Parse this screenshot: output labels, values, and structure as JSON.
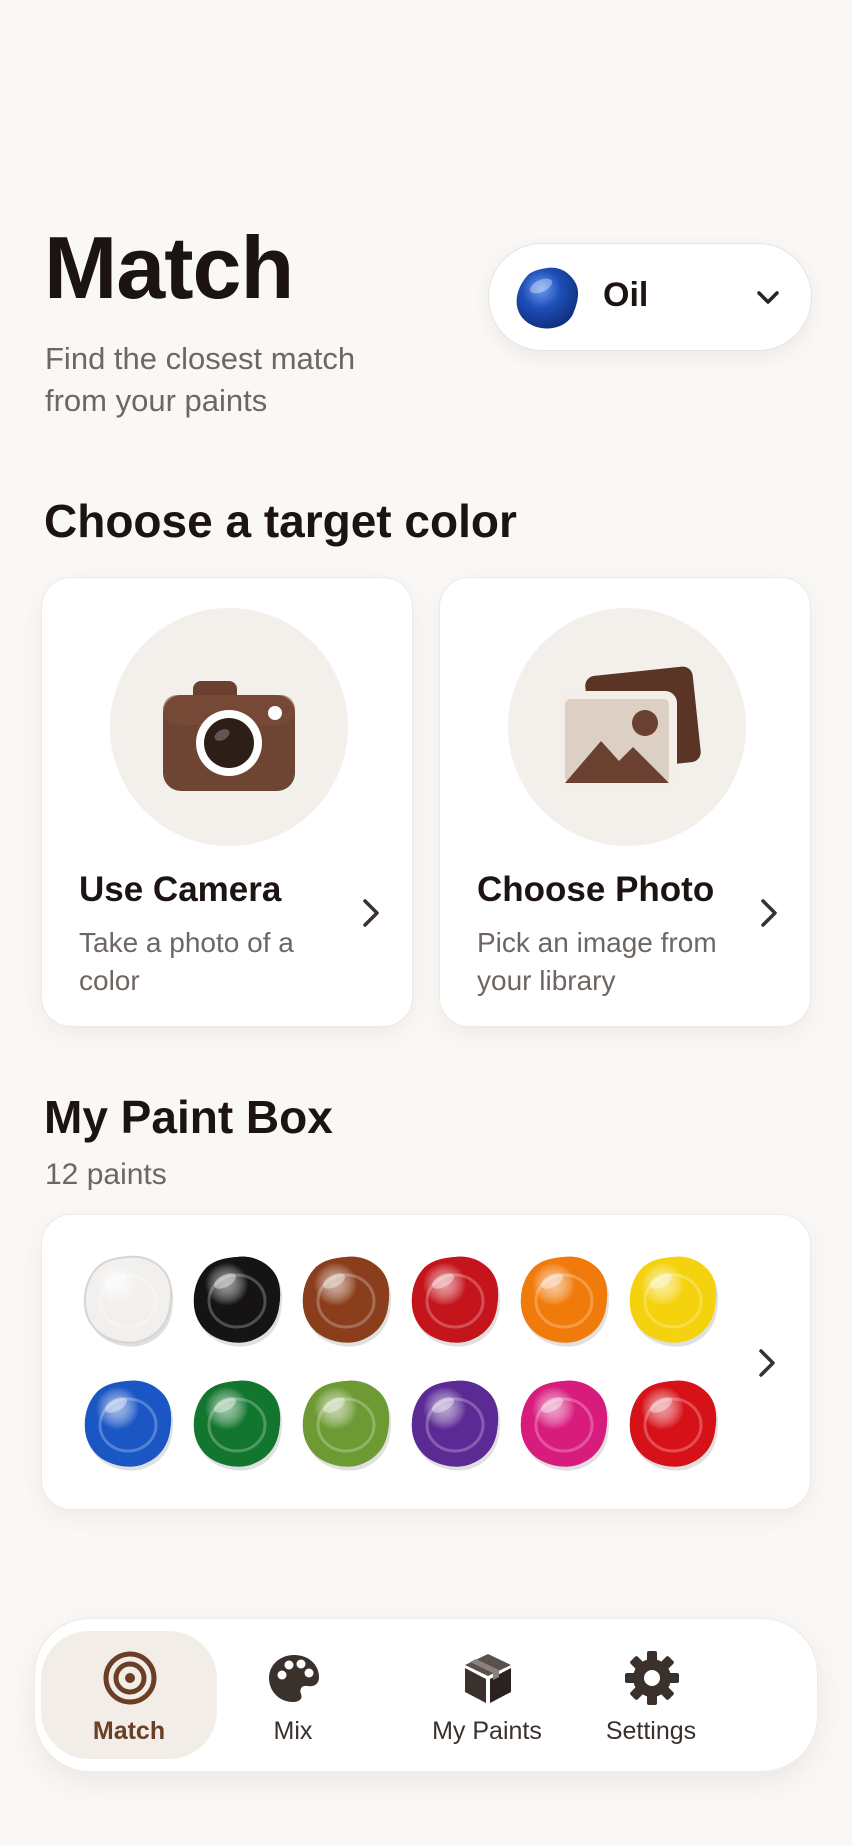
{
  "header": {
    "title": "Match",
    "subtitle": "Find the closest match from your paints"
  },
  "medium_selector": {
    "label": "Oil",
    "swatch_color": "#1E4FB8",
    "icon": "chevron-down-icon"
  },
  "target_section": {
    "title": "Choose a target color",
    "options": [
      {
        "title": "Use Camera",
        "description": "Take a photo of a color",
        "icon": "camera-icon"
      },
      {
        "title": "Choose Photo",
        "description": "Pick an image from your library",
        "icon": "photo-library-icon"
      }
    ]
  },
  "paint_box": {
    "title": "My Paint Box",
    "count": "12 paints",
    "paints": [
      {
        "name": "white",
        "color": "#F2F0EE"
      },
      {
        "name": "black",
        "color": "#151313"
      },
      {
        "name": "brown",
        "color": "#8A3E1C"
      },
      {
        "name": "red",
        "color": "#C4141C"
      },
      {
        "name": "orange",
        "color": "#F07A0A"
      },
      {
        "name": "yellow",
        "color": "#F4D20E"
      },
      {
        "name": "blue",
        "color": "#1A56C4"
      },
      {
        "name": "green",
        "color": "#13762F"
      },
      {
        "name": "olive",
        "color": "#6E9A34"
      },
      {
        "name": "purple",
        "color": "#5B2A94"
      },
      {
        "name": "magenta",
        "color": "#D81C7E"
      },
      {
        "name": "crimson",
        "color": "#D61218"
      }
    ]
  },
  "nav": {
    "items": [
      {
        "label": "Match",
        "icon": "target-icon",
        "active": true
      },
      {
        "label": "Mix",
        "icon": "palette-icon",
        "active": false
      },
      {
        "label": "My Paints",
        "icon": "box-icon",
        "active": false
      },
      {
        "label": "Settings",
        "icon": "gear-icon",
        "active": false
      }
    ]
  },
  "colors": {
    "accent_brown": "#6B3E26",
    "background": "#FAF8F6"
  }
}
